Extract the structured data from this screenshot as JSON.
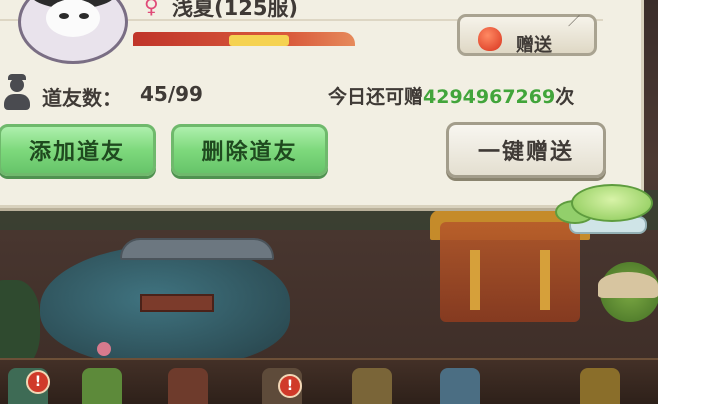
{
  "profile": {
    "gender_symbol": "♀",
    "name": "浅夏(125服)",
    "gift_button_label": "赠送",
    "corner_mark": "／"
  },
  "friends": {
    "count_label": "道友数：",
    "count_value": "45/99",
    "gift_remaining_prefix": "今日还可赠",
    "gift_remaining_value": "4294967269",
    "gift_remaining_suffix": "次"
  },
  "actions": {
    "add_friend": "添加道友",
    "delete_friend": "删除道友",
    "one_key_gift": "一键赠送"
  },
  "bottom_bar": {
    "alert_symbol": "!"
  },
  "colors": {
    "panel_bg": "#f2efe3",
    "green_button": "#7ed97c",
    "gift_count_green": "#42a53b",
    "gender_pink": "#e04a78"
  },
  "icons": [
    "avatar-portrait",
    "female-icon",
    "peach-gift-icon",
    "friend-silhouette-icon",
    "lily-pad-icon",
    "alert-icon"
  ]
}
